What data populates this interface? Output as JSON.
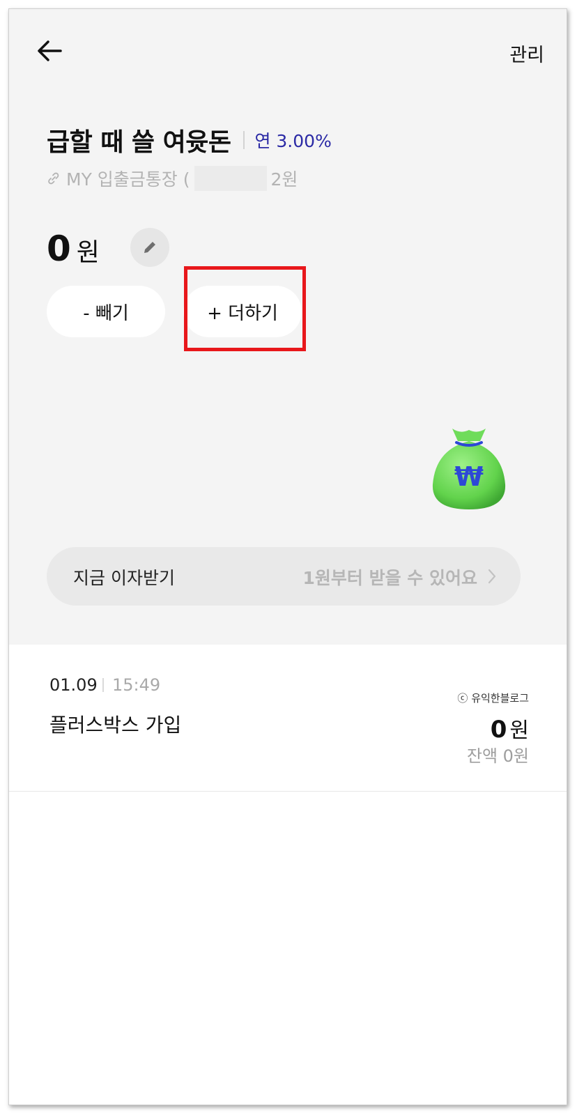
{
  "header": {
    "manage_label": "관리"
  },
  "account": {
    "name": "급할 때 쓸 여윳돈",
    "rate": "연 3.00%",
    "linked_prefix": "MY 입출금통장 (",
    "linked_suffix": "2원"
  },
  "balance": {
    "amount": "0",
    "unit": "원"
  },
  "actions": {
    "withdraw_label": "- 빼기",
    "deposit_label": "+ 더하기"
  },
  "interest": {
    "label": "지금 이자받기",
    "value": "1원부터 받을 수 있어요"
  },
  "transactions": [
    {
      "date": "01.09",
      "time": "15:49",
      "name": "플러스박스 가입",
      "amount": "0",
      "unit": "원",
      "balance": "잔액 0원"
    }
  ],
  "watermark": "ⓒ 유익한블로그",
  "colors": {
    "rate": "#2b2aa5",
    "highlight": "#e8171b",
    "bag": "#6fdc5a",
    "won_symbol": "#2d48d6"
  }
}
